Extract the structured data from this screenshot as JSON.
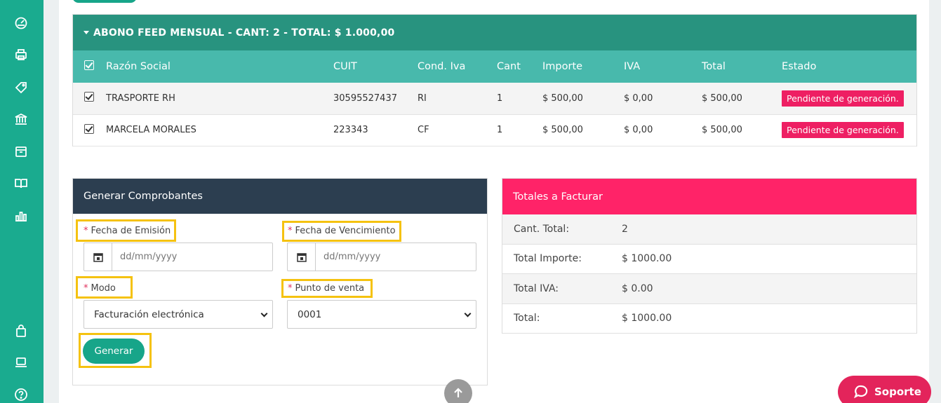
{
  "group": {
    "title": "ABONO FEED MENSUAL - CANT: 2 - TOTAL: $ 1.000,00",
    "columns": [
      "Razón Social",
      "CUIT",
      "Cond. Iva",
      "Cant",
      "Importe",
      "IVA",
      "Total",
      "Estado"
    ],
    "rows": [
      {
        "razon": "TRASPORTE RH",
        "cuit": "30595527437",
        "cond": "RI",
        "cant": "1",
        "importe": "$ 500,00",
        "iva": "$ 0,00",
        "total": "$ 500,00",
        "estado": "Pendiente de generación."
      },
      {
        "razon": "MARCELA MORALES",
        "cuit": "223343",
        "cond": "CF",
        "cant": "1",
        "importe": "$ 500,00",
        "iva": "$ 0,00",
        "total": "$ 500,00",
        "estado": "Pendiente de generación."
      }
    ]
  },
  "generar": {
    "title": "Generar Comprobantes",
    "fecha_emision_label": "Fecha de Emisión",
    "fecha_vencimiento_label": "Fecha de Vencimiento",
    "date_placeholder": "dd/mm/yyyy",
    "modo_label": "Modo",
    "modo_value": "Facturación electrónica",
    "punto_label": "Punto de venta",
    "punto_value": "0001",
    "button": "Generar",
    "required_mark": "*"
  },
  "totales": {
    "title": "Totales a Facturar",
    "rows": [
      {
        "label": "Cant. Total:",
        "value": "2"
      },
      {
        "label": "Total Importe:",
        "value": "$ 1000.00"
      },
      {
        "label": "Total IVA:",
        "value": "$ 0.00"
      },
      {
        "label": "Total:",
        "value": "$ 1000.00"
      }
    ]
  },
  "soporte": {
    "label": "Soporte"
  },
  "colors": {
    "sidebar": "#1aab8f",
    "group_header": "#28937f",
    "table_header": "#48b9ac",
    "badge": "#ee1f63",
    "generar_header": "#2c3e50",
    "totales_header": "#ff2368",
    "highlight": "#f5c210"
  }
}
